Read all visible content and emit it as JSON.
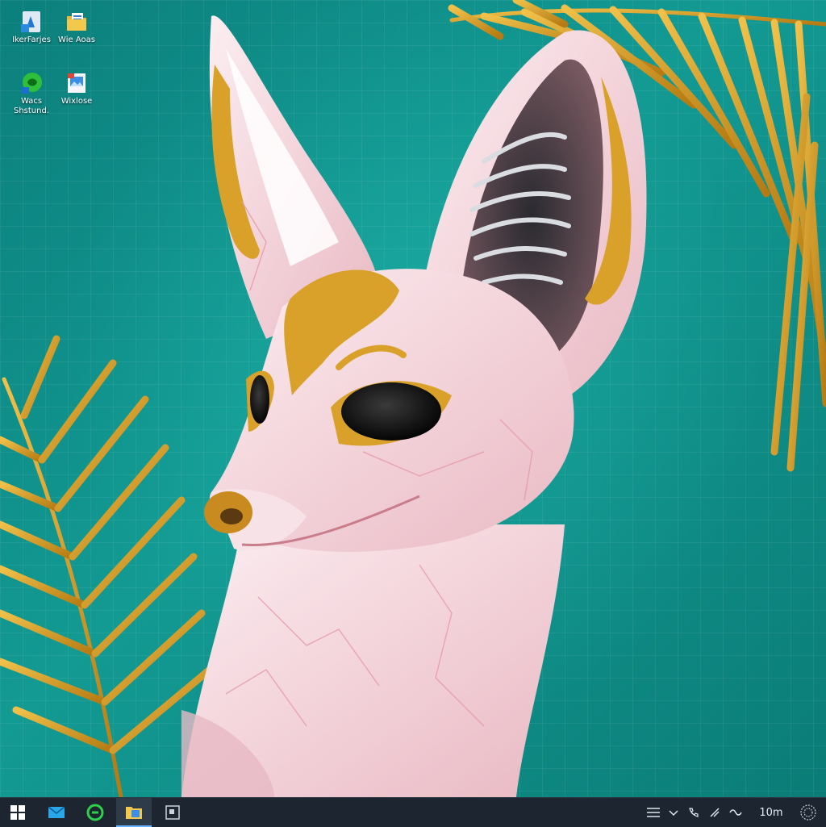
{
  "desktop": {
    "icons": [
      {
        "label": "IkerFarjes",
        "icon": "azure-app-icon"
      },
      {
        "label": "Wie Aoas",
        "icon": "folder-document-icon"
      },
      {
        "label": "Wacs Shstund.",
        "icon": "green-app-icon"
      },
      {
        "label": "Wixlose",
        "icon": "picture-file-icon"
      }
    ]
  },
  "taskbar": {
    "buttons": [
      {
        "name": "start-button",
        "icon": "windows-logo-icon"
      },
      {
        "name": "taskbar-mail",
        "icon": "mail-icon"
      },
      {
        "name": "taskbar-edge",
        "icon": "green-circle-app-icon"
      },
      {
        "name": "taskbar-explorer",
        "icon": "file-explorer-icon"
      },
      {
        "name": "taskbar-app",
        "icon": "app-window-icon"
      }
    ],
    "tray": {
      "items": [
        "list-icon",
        "chevron-up-icon",
        "phone-icon",
        "pen-icon",
        "link-icon"
      ],
      "clock": "10m"
    }
  },
  "colors": {
    "background": "#0f8a86",
    "taskbar": "#1c2530",
    "accent": "#66b3ff",
    "gold": "#d7a02b",
    "fox_pink": "#f3d7dc"
  }
}
